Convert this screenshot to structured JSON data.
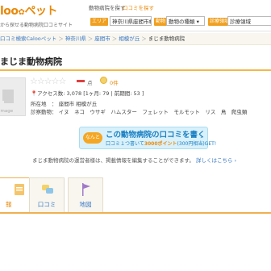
{
  "header": {
    "logo": "loo",
    "logo_suffix": "ペット",
    "tagline": "から探せる動物病院口コミサイト",
    "search_label": "動物病院を探す",
    "search_sep": "|",
    "review_search_link": "口コミを探す",
    "area_tag": "エリア",
    "area_value": "神奈川県座間市相",
    "type_tag": "動物",
    "type_value": "動物の種類",
    "field_tag": "診療領域",
    "field_value": "診療領域"
  },
  "breadcrumb": {
    "items": [
      "口コミ検索Calooペット",
      "神奈川県",
      "座間市",
      "相模が丘",
      "まじま動物病院"
    ],
    "sep": "＞"
  },
  "clinic": {
    "name": "まじま動物病院",
    "thumb_text": "image",
    "stars": "☆☆☆☆☆",
    "score_unit": "点",
    "like_count": "0件",
    "access": "アクセス数: 3,078 [1ヶ月: 79 | 前期間: 53 ]",
    "address_label": "所在地",
    "address": "： 座間市 相模が丘",
    "animals_label": "診察動物",
    "animals": "： イヌ　ネコ　ウサギ　ハムスター　フェレット　モルモット　リス　鳥　爬虫類"
  },
  "banner": {
    "badge": "なんと",
    "main": "この動物病院の口コミを書く",
    "sub_prefix": "口コミ１つ書いて",
    "sub_points": "3000ポイント",
    "sub_suffix": "(300円相当)GET!",
    "arrow": "›"
  },
  "note": {
    "text": "まじま動物病院の運営者様は、掲載情報を編集することができます。",
    "link": "詳しくはこちら ›"
  },
  "tabs": [
    {
      "label": "報"
    },
    {
      "label": "口コミ"
    },
    {
      "label": "地図"
    }
  ]
}
